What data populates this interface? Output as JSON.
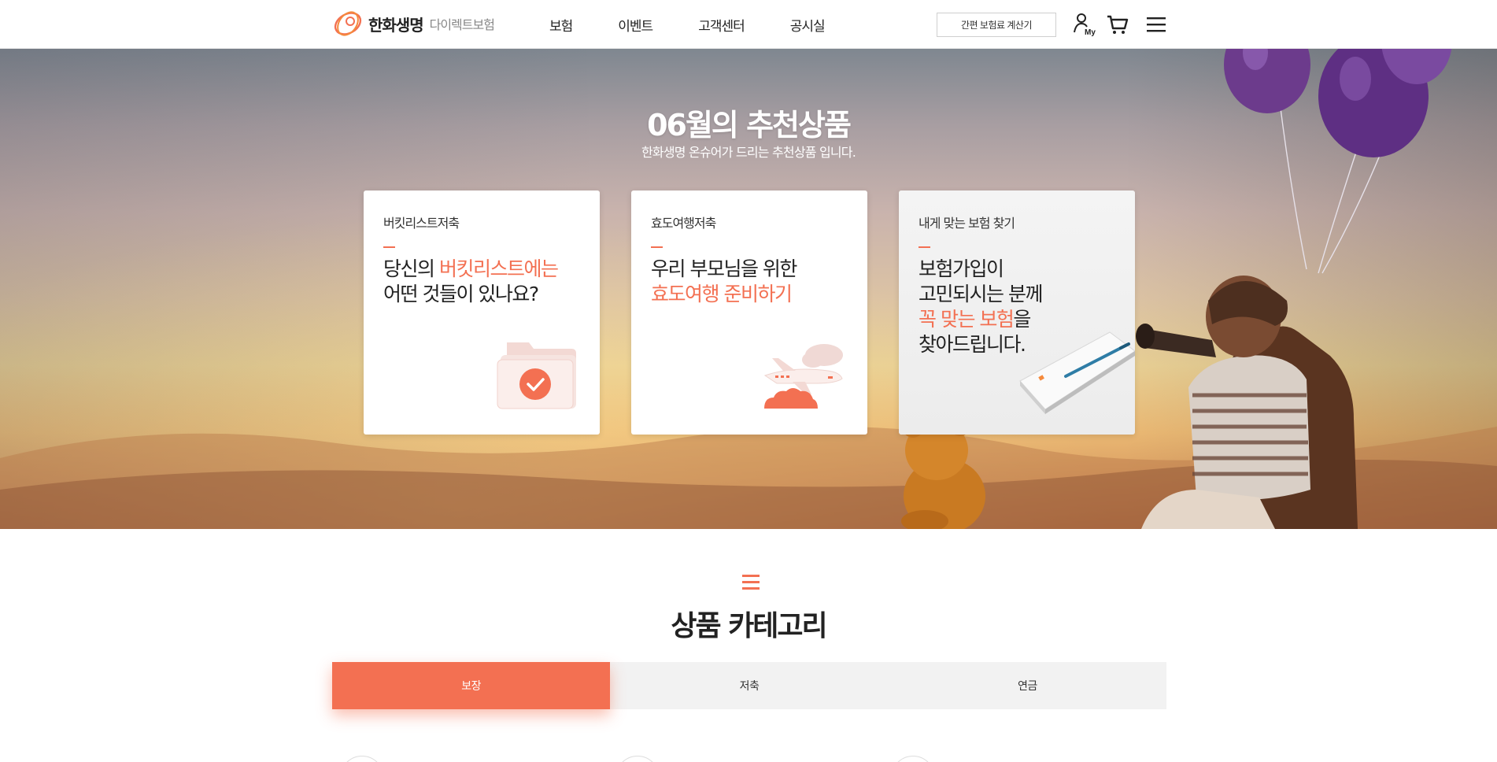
{
  "header": {
    "logo": {
      "name": "한화생명",
      "sub": "다이렉트보험"
    },
    "nav": [
      {
        "label": "보험"
      },
      {
        "label": "이벤트"
      },
      {
        "label": "고객센터"
      },
      {
        "label": "공시실"
      }
    ],
    "calc_button": "간편 보험료 계산기",
    "icons": [
      "my-icon",
      "cart-icon",
      "menu-icon"
    ],
    "my_label": "My"
  },
  "hero": {
    "title": "06월의 추천상품",
    "subtitle": "한화생명 온슈어가 드리는 추천상품 입니다.",
    "cards": [
      {
        "category": "버킷리스트저축",
        "line1_plain": "당신의 ",
        "line1_hl": "버킷리스트에는",
        "line2": "어떤 것들이 있나요?"
      },
      {
        "category": "효도여행저축",
        "line1": "우리 부모님을 위한",
        "line2_hl": "효도여행 준비하기"
      },
      {
        "category": "내게 맞는 보험 찾기",
        "line1": "보험가입이",
        "line2": "고민되시는 분께",
        "line3_hl": "꼭 맞는 보험",
        "line3_plain": "을",
        "line4": "찾아드립니다."
      }
    ]
  },
  "category": {
    "title": "상품 카테고리",
    "tabs": [
      {
        "label": "보장",
        "active": true
      },
      {
        "label": "저축",
        "active": false
      },
      {
        "label": "연금",
        "active": false
      }
    ]
  },
  "colors": {
    "accent": "#f37052",
    "tab_bg": "#f2f2f2"
  }
}
